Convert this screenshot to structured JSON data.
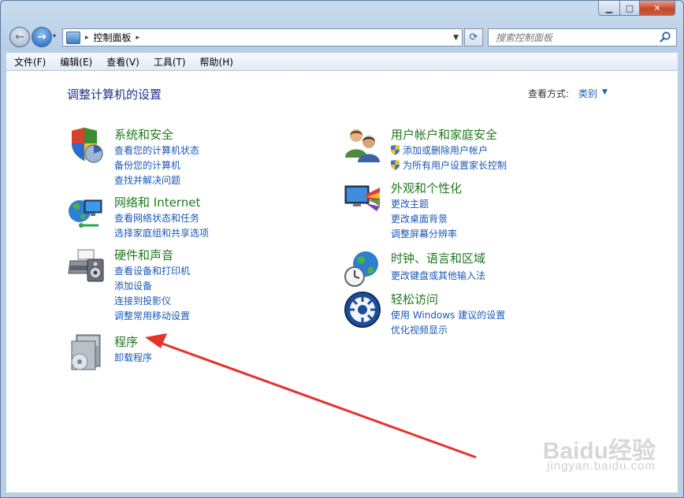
{
  "window": {
    "controls": {
      "minimize": "▁",
      "maximize": "□",
      "close": "✕"
    }
  },
  "nav": {
    "back_glyph": "←",
    "forward_glyph": "→",
    "history_glyph": "▾",
    "breadcrumb": [
      "控制面板"
    ],
    "breadcrumb_sep": "▸",
    "address_drop_glyph": "▼",
    "refresh_glyph": "⟳",
    "search_placeholder": "搜索控制面板"
  },
  "menubar": {
    "items": [
      "文件(F)",
      "编辑(E)",
      "查看(V)",
      "工具(T)",
      "帮助(H)"
    ]
  },
  "content": {
    "page_title": "调整计算机的设置",
    "view_by_label": "查看方式:",
    "view_by_value": "类别",
    "view_by_arrow": "▼",
    "categories": [
      {
        "title": "系统和安全",
        "icon": "shield-chart-icon",
        "links": [
          "查看您的计算机状态",
          "备份您的计算机",
          "查找并解决问题"
        ]
      },
      {
        "title": "网络和 Internet",
        "icon": "network-globe-icon",
        "links": [
          "查看网络状态和任务",
          "选择家庭组和共享选项"
        ]
      },
      {
        "title": "硬件和声音",
        "icon": "printer-speaker-icon",
        "links": [
          "查看设备和打印机",
          "添加设备",
          "连接到投影仪",
          "调整常用移动设置"
        ]
      },
      {
        "title": "程序",
        "icon": "programs-disc-icon",
        "links": [
          "卸载程序"
        ]
      },
      {
        "title": "用户帐户和家庭安全",
        "icon": "users-icon",
        "links": [
          "添加或删除用户帐户",
          "为所有用户设置家长控制"
        ]
      },
      {
        "title": "外观和个性化",
        "icon": "appearance-monitor-icon",
        "links": [
          "更改主题",
          "更改桌面背景",
          "调整屏幕分辨率"
        ]
      },
      {
        "title": "时钟、语言和区域",
        "icon": "clock-globe-icon",
        "links": [
          "更改键盘或其他输入法"
        ]
      },
      {
        "title": "轻松访问",
        "icon": "ease-of-access-icon",
        "links": [
          "使用 Windows 建议的设置",
          "优化视频显示"
        ]
      }
    ]
  },
  "watermark": {
    "brand": "Baidu经验",
    "url": "jingyan.baidu.com"
  },
  "colors": {
    "title_green": "#1f7a1f",
    "link_blue": "#1a58b7",
    "heading_navy": "#1e3287",
    "arrow_red": "#e8312a"
  }
}
